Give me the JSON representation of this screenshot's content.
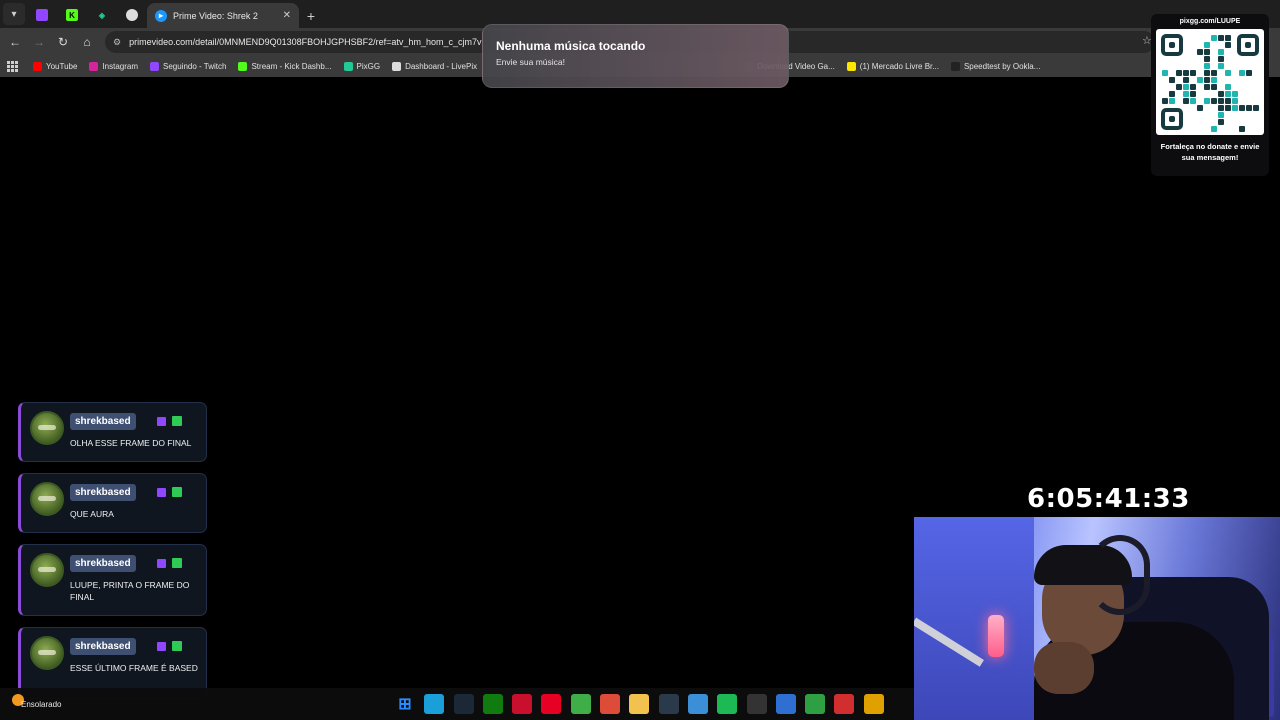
{
  "browser": {
    "active_tab_title": "Prime Video: Shrek 2",
    "url": "primevideo.com/detail/0MNMEND9Q01308FBOHJGPHSBF2/ref=atv_hm_hom_c_cjm7v",
    "bookmarks": [
      {
        "label": "YouTube",
        "icon": "youtube-icon",
        "color": "#ff0000"
      },
      {
        "label": "Instagram",
        "icon": "instagram-icon",
        "color": "#d6249f"
      },
      {
        "label": "Seguindo - Twitch",
        "icon": "twitch-icon",
        "color": "#9146ff"
      },
      {
        "label": "Stream - Kick Dashb...",
        "icon": "kick-icon",
        "color": "#53fc18"
      },
      {
        "label": "PixGG",
        "icon": "pixgg-icon",
        "color": "#20c997"
      },
      {
        "label": "Dashboard - LivePix",
        "icon": "livepix-icon",
        "color": "#dddddd"
      },
      {
        "label": "Download Video Ga...",
        "icon": "download-icon",
        "color": "#444444"
      },
      {
        "label": "(1) Mercado Livre Br...",
        "icon": "mercadolivre-icon",
        "color": "#ffe600"
      },
      {
        "label": "Speedtest by Ookla...",
        "icon": "speedtest-icon",
        "color": "#222222"
      }
    ]
  },
  "music_widget": {
    "title": "Nenhuma música tocando",
    "subtitle": "Envie sua música!"
  },
  "donation": {
    "url": "pixgg.com/LUUPE",
    "message": "Fortaleça no donate e envie sua mensagem!"
  },
  "chat": [
    {
      "user": "shrekbased",
      "text": "OLHA ESSE FRAME DO FINAL"
    },
    {
      "user": "shrekbased",
      "text": "QUE AURA"
    },
    {
      "user": "shrekbased",
      "text": "LUUPE, PRINTA O FRAME DO FINAL"
    },
    {
      "user": "shrekbased",
      "text": "ESSE ÚLTIMO FRAME É BASED"
    }
  ],
  "timer": "6:05:41:33",
  "taskbar": {
    "weather": "Ensolarado",
    "apps": [
      {
        "icon": "windows-start-icon",
        "color": "#2b8cff"
      },
      {
        "icon": "edge-icon",
        "color": "#1a9fd9"
      },
      {
        "icon": "steam-icon",
        "color": "#1b2838"
      },
      {
        "icon": "xbox-icon",
        "color": "#107c10"
      },
      {
        "icon": "app-a-icon",
        "color": "#c8102e"
      },
      {
        "icon": "pinterest-icon",
        "color": "#e60023"
      },
      {
        "icon": "app-b-icon",
        "color": "#3fae49"
      },
      {
        "icon": "chrome-icon",
        "color": "#dd4b39"
      },
      {
        "icon": "file-explorer-icon",
        "color": "#f2c14e"
      },
      {
        "icon": "media-icon",
        "color": "#2a3a4a"
      },
      {
        "icon": "notepad-icon",
        "color": "#3a8fd6"
      },
      {
        "icon": "spotify-icon",
        "color": "#1db954"
      },
      {
        "icon": "obs-icon",
        "color": "#333333"
      },
      {
        "icon": "app-blue-icon",
        "color": "#2f6fd1"
      },
      {
        "icon": "app-green-icon",
        "color": "#2ea043"
      },
      {
        "icon": "app-red-icon",
        "color": "#d12f2f"
      },
      {
        "icon": "chrome-active-icon",
        "color": "#e0a100"
      }
    ]
  }
}
